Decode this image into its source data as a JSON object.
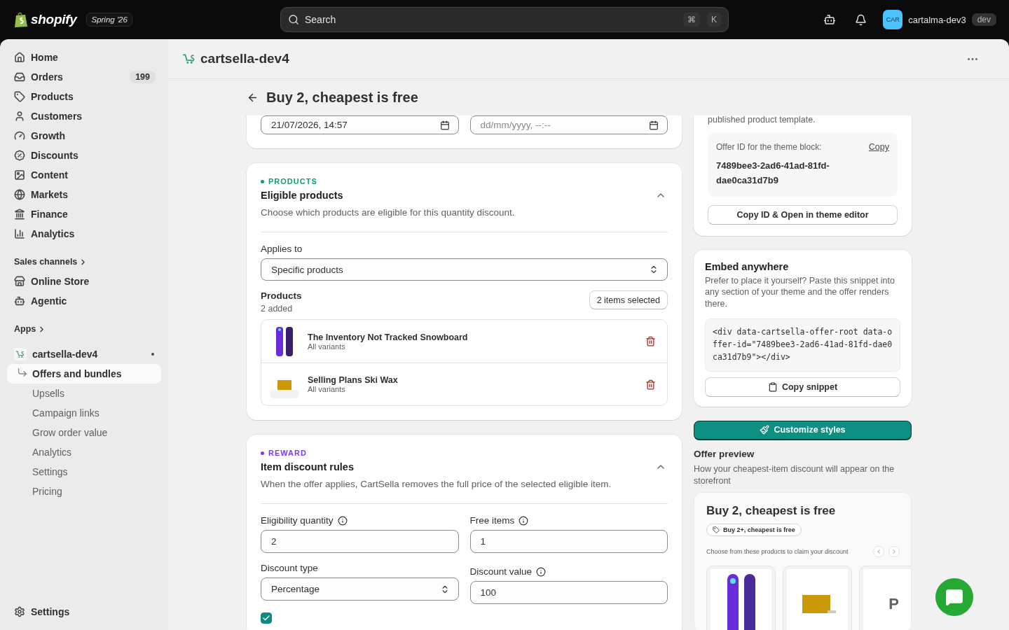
{
  "topbar": {
    "brand": "shopify",
    "release": "Spring '26",
    "search": {
      "placeholder": "Search",
      "keys": [
        "⌘",
        "K"
      ]
    },
    "avatar": "CAR",
    "store": "cartalma-dev3",
    "badge": "dev"
  },
  "sidebar": {
    "nav": [
      {
        "label": "Home",
        "selected": false
      },
      {
        "label": "Orders",
        "badge": "199",
        "selected": false
      },
      {
        "label": "Products",
        "selected": false
      },
      {
        "label": "Customers",
        "selected": false
      },
      {
        "label": "Growth",
        "selected": false
      },
      {
        "label": "Discounts",
        "selected": false
      },
      {
        "label": "Content",
        "selected": false
      },
      {
        "label": "Markets",
        "selected": false
      },
      {
        "label": "Finance",
        "selected": false
      },
      {
        "label": "Analytics",
        "selected": false
      }
    ],
    "sales_channels": {
      "title": "Sales channels",
      "items": [
        {
          "label": "Online Store",
          "selected": false
        },
        {
          "label": "Agentic",
          "selected": false
        }
      ]
    },
    "apps": {
      "title": "Apps",
      "app": {
        "name": "cartsella-dev4",
        "children": [
          {
            "label": "Offers and bundles",
            "selected": true
          },
          {
            "label": "Upsells",
            "selected": false
          },
          {
            "label": "Campaign links",
            "selected": false
          },
          {
            "label": "Grow order value",
            "selected": false
          },
          {
            "label": "Analytics",
            "selected": false
          },
          {
            "label": "Settings",
            "selected": false
          },
          {
            "label": "Pricing",
            "selected": false
          }
        ]
      }
    },
    "footer": {
      "label": "Settings",
      "selected": false
    }
  },
  "app_header": {
    "title": "cartsella-dev4"
  },
  "page": {
    "title": "Buy 2, cheapest is free"
  },
  "schedule": {
    "start_value": "21/07/2026, 14:57",
    "end_placeholder": "dd/mm/yyyy, --:--"
  },
  "sections": [
    {
      "kind": "products",
      "tag": "PRODUCTS",
      "color": "#0e9f6e",
      "title": "Eligible products",
      "description": "Choose which products are eligible for this quantity discount.",
      "expanded": true,
      "applies_to": {
        "label": "Applies to",
        "value": "Specific products"
      },
      "products_label": "Products",
      "count": "2 added",
      "picker_button": "2 items selected",
      "items": [
        {
          "name": "The Inventory Not Tracked Snowboard",
          "variants": "All variants",
          "kind": "snowboard"
        },
        {
          "name": "Selling Plans Ski Wax",
          "variants": "All variants",
          "kind": "wax"
        }
      ]
    },
    {
      "kind": "reward",
      "tag": "REWARD",
      "color": "#7c3aed",
      "title": "Item discount rules",
      "description": "When the offer applies, CartSella removes the full price of the selected eligible item.",
      "expanded": true,
      "fields": [
        {
          "label": "Eligibility quantity",
          "info": true,
          "kind": "input",
          "value": "2"
        },
        {
          "label": "Free items",
          "info": true,
          "kind": "input",
          "value": "1"
        },
        {
          "label": "Discount type",
          "info": false,
          "kind": "select",
          "value": "Percentage"
        },
        {
          "label": "Discount value",
          "info": true,
          "kind": "input",
          "value": "100"
        }
      ],
      "checkbox": {
        "checked": true
      }
    }
  ],
  "theme_block": {
    "note": "published product template.",
    "offer_id_label": "Offer ID for the theme block:",
    "copy_link": "Copy",
    "offer_id": "7489bee3-2ad6-41ad-81fd-dae0ca31d7b9",
    "button": "Copy ID & Open in theme editor"
  },
  "embed": {
    "title": "Embed anywhere",
    "description": "Prefer to place it yourself? Paste this snippet into any section of your theme and the offer renders there.",
    "snippet": "<div data-cartsella-offer-root data-offer-id=\"7489bee3-2ad6-41ad-81fd-dae0ca31d7b9\"></div>",
    "button": "Copy snippet"
  },
  "customize_button": "Customize styles",
  "preview": {
    "title": "Offer preview",
    "description": "How your cheapest-item discount will appear on the storefront",
    "card": {
      "title": "Buy 2, cheapest is free",
      "badge": "Buy 2+, cheapest is free",
      "caption": "Choose from these products to claim your discount",
      "products": [
        {
          "kind": "snowboard"
        },
        {
          "kind": "wax"
        },
        {
          "kind": "placeholder",
          "letter": "P"
        }
      ]
    }
  }
}
